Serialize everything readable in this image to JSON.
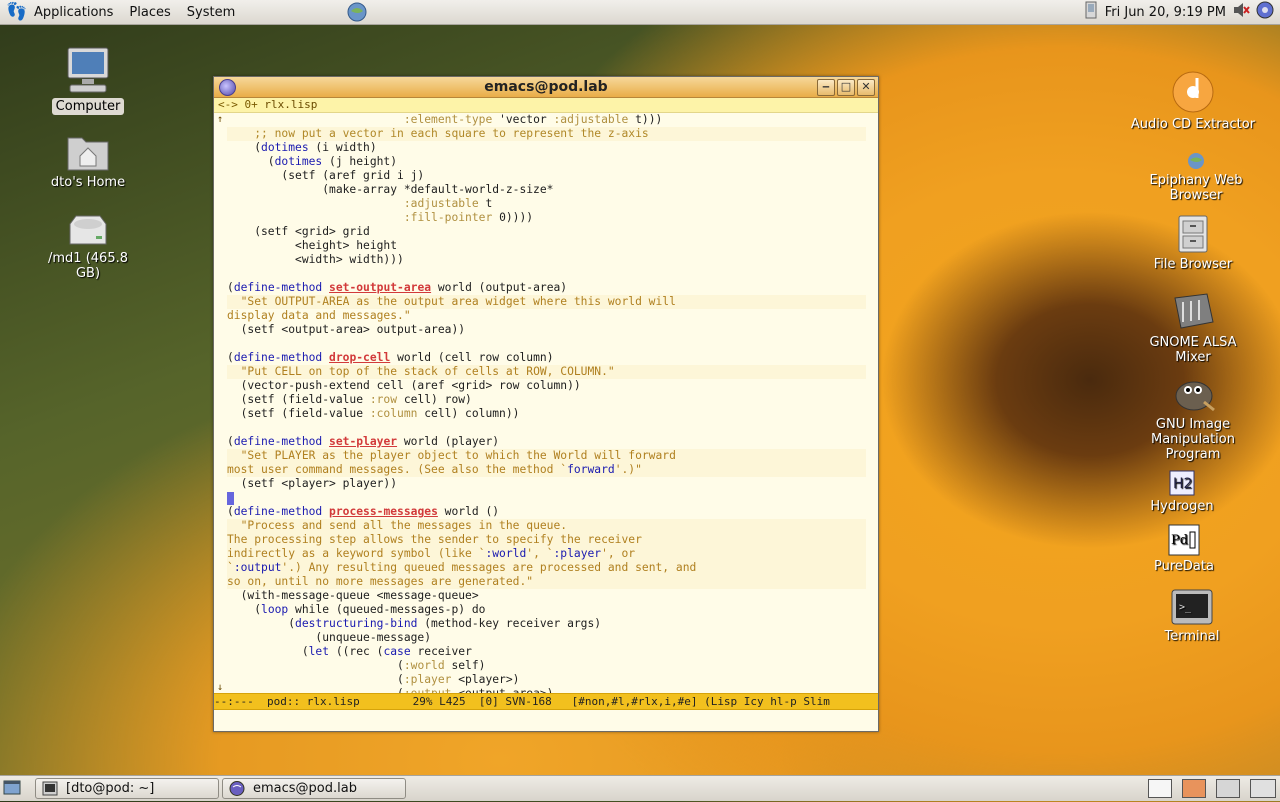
{
  "top_panel": {
    "menus": [
      "Applications",
      "Places",
      "System"
    ],
    "clock": "Fri Jun 20,  9:19 PM"
  },
  "desktop_left": [
    {
      "label": "Computer"
    },
    {
      "label": "dto's Home"
    },
    {
      "label": "/md1 (465.8 GB)"
    }
  ],
  "desktop_right": [
    {
      "label": "Audio CD Extractor"
    },
    {
      "label": "Epiphany Web Browser"
    },
    {
      "label": "File Browser"
    },
    {
      "label": "GNOME ALSA Mixer"
    },
    {
      "label": "GNU Image Manipulation Program"
    },
    {
      "label": "Hydrogen"
    },
    {
      "label": "PureData"
    },
    {
      "label": "Terminal"
    }
  ],
  "emacs": {
    "title": "emacs@pod.lab",
    "header_prefix": "<-> 0+",
    "header_file": "rlx.lisp",
    "modeline": "--:---  pod:: rlx.lisp        29% L425  [0] SVN-168   [#non,#l,#rlx,i,#e] (Lisp Icy hl-p Slim"
  },
  "taskbar": {
    "tasks": [
      "[dto@pod: ~]",
      "emacs@pod.lab"
    ]
  },
  "colors": {
    "titlebar": "#e9ad48",
    "modeline": "#f2c01e",
    "keyword": "#1a1ab0",
    "function_name": "#d23a3a",
    "string": "#b08020",
    "buffer_bg": "#fffce8"
  }
}
